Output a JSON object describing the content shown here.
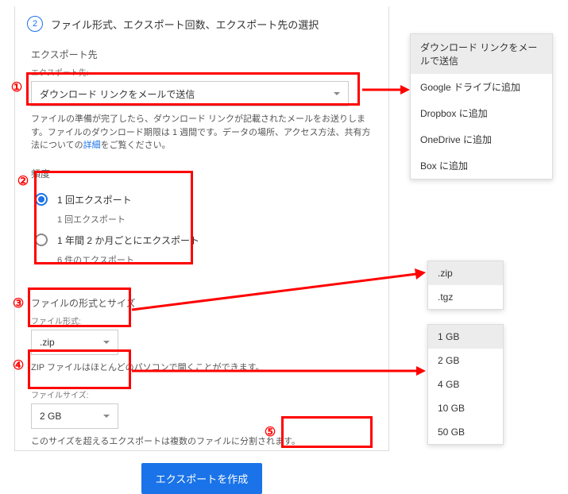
{
  "step": {
    "number": "2",
    "title": "ファイル形式、エクスポート回数、エクスポート先の選択"
  },
  "destination": {
    "heading": "エクスポート先",
    "label": "エクスポート先:",
    "selected": "ダウンロード リンクをメールで送信",
    "help_pre": "ファイルの準備が完了したら、ダウンロード リンクが記載されたメールをお送りします。ファイルのダウンロード期限は 1 週間です。データの場所、アクセス方法、共有方法についての",
    "help_link": "詳細",
    "help_post": "をご覧ください。"
  },
  "frequency": {
    "heading": "頻度",
    "opt1_label": "1 回エクスポート",
    "opt1_sub": "1 回エクスポート",
    "opt2_label": "1 年間 2 か月ごとにエクスポート",
    "opt2_sub": "6 件のエクスポート"
  },
  "filetype": {
    "heading": "ファイルの形式とサイズ",
    "label": "ファイル形式:",
    "selected": ".zip",
    "help": "ZIP ファイルはほとんどのパソコンで開くことができます。"
  },
  "filesize": {
    "label": "ファイルサイズ:",
    "selected": "2 GB",
    "help": "このサイズを超えるエクスポートは複数のファイルに分割されます。"
  },
  "create_button": "エクスポートを作成",
  "dest_options": {
    "o1": "ダウンロード リンクをメールで送信",
    "o2": "Google ドライブに追加",
    "o3": "Dropbox に追加",
    "o4": "OneDrive に追加",
    "o5": "Box に追加"
  },
  "type_options": {
    "t1": ".zip",
    "t2": ".tgz"
  },
  "size_options": {
    "s1": "1 GB",
    "s2": "2 GB",
    "s3": "4 GB",
    "s4": "10 GB",
    "s5": "50 GB"
  },
  "annotations": {
    "n1": "①",
    "n2": "②",
    "n3": "③",
    "n4": "④",
    "n5": "⑤"
  }
}
